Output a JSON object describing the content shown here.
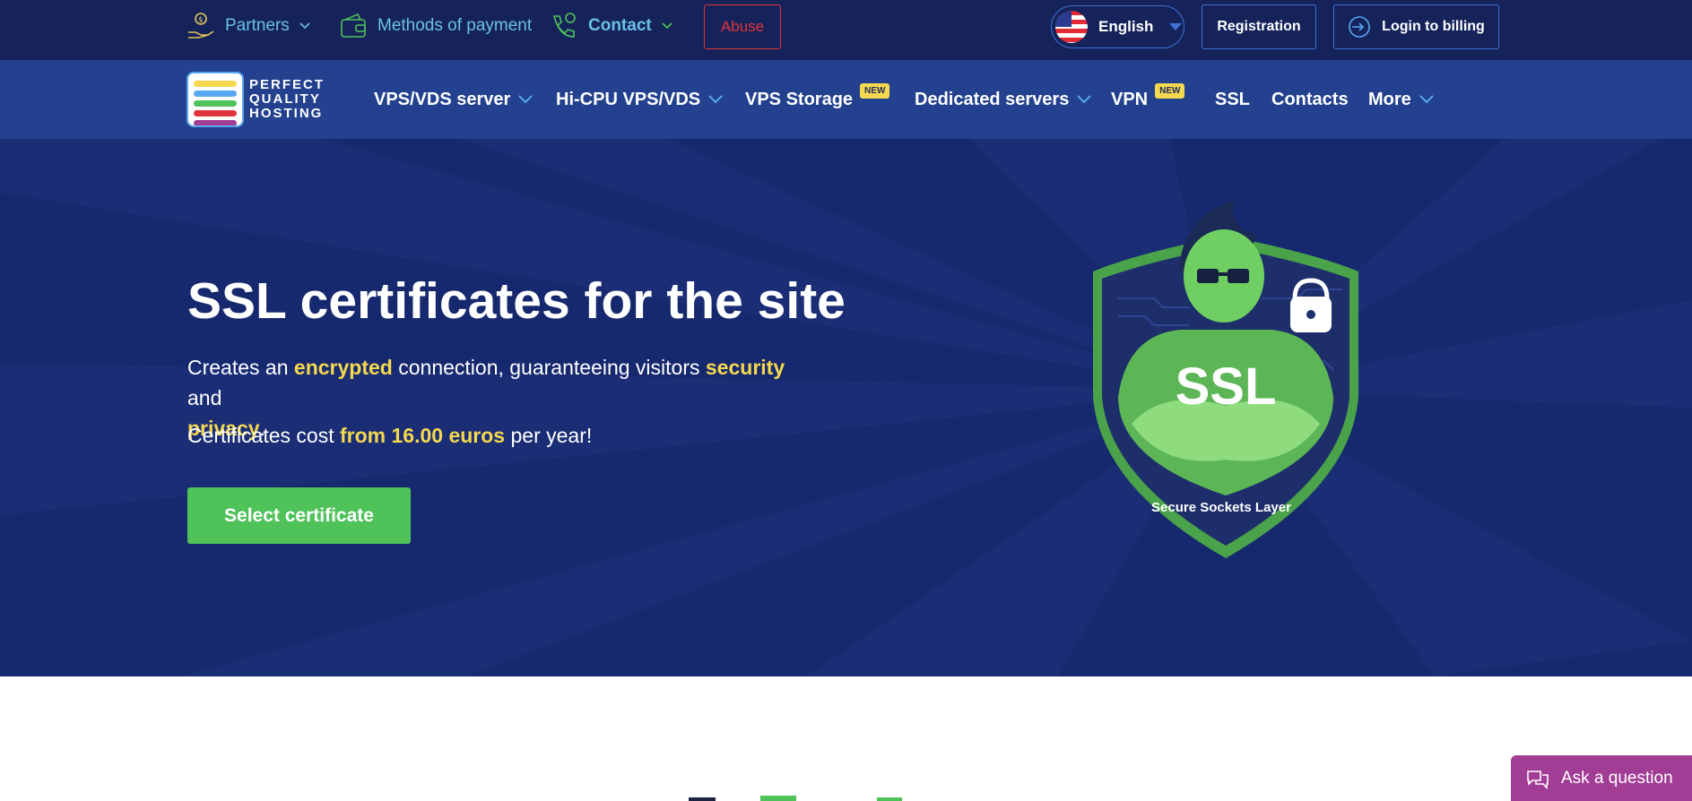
{
  "topbar": {
    "partners_label": "Partners",
    "methods_label": "Methods of payment",
    "contact_label": "Contact",
    "abuse_label": "Abuse",
    "language_label": "English",
    "registration_label": "Registration",
    "login_label": "Login to billing"
  },
  "logo": {
    "line1": "PERFECT",
    "line2": "QUALITY",
    "line3": "HOSTING"
  },
  "nav": {
    "items": [
      {
        "label": "VPS/VDS server",
        "dropdown": true
      },
      {
        "label": "Hi-CPU VPS/VDS",
        "dropdown": true
      },
      {
        "label": "VPS Storage",
        "badge": "NEW"
      },
      {
        "label": "Dedicated servers",
        "dropdown": true
      },
      {
        "label": "VPN",
        "badge": "NEW"
      },
      {
        "label": "SSL"
      },
      {
        "label": "Contacts"
      },
      {
        "label": "More",
        "dropdown": true
      }
    ]
  },
  "hero": {
    "title": "SSL certificates for the site",
    "desc_1": "Creates an ",
    "desc_hl_1": "encrypted",
    "desc_2": " connection, guaranteeing visitors ",
    "desc_hl_2": "security",
    "desc_3": " and ",
    "desc_hl_3": "privacy",
    "desc_4": ".",
    "cost_1": "Certificates cost ",
    "cost_hl": "from 16.00 euros",
    "cost_2": " per year!",
    "cta_label": "Select certificate",
    "shield_text": "SSL",
    "shield_caption": "Secure Sockets Layer"
  },
  "chat": {
    "label": "Ask a question"
  },
  "colors": {
    "topbar_bg": "#15235a",
    "nav_bg": "#23418e",
    "hero_bg": "#17296e",
    "accent_yellow": "#f4d84f",
    "cta_green": "#4fc25a",
    "abuse_red": "#e0343a",
    "chat_purple": "#a23d96"
  },
  "icons": {
    "partners": "hand-coin-icon",
    "methods": "wallet-icon",
    "contact": "phone-icon",
    "login": "login-arrow-icon",
    "chat": "chat-bubbles-icon",
    "language": "us-flag-icon"
  }
}
